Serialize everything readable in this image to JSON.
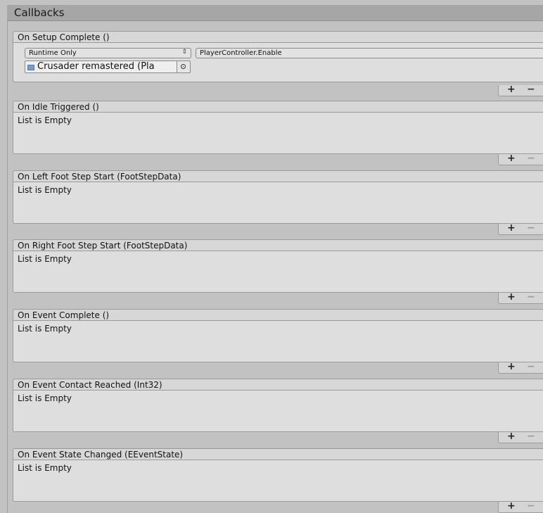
{
  "section_title": "Callbacks",
  "events": [
    {
      "title": "On Setup Complete ()",
      "listeners": [
        {
          "mode": "Runtime Only",
          "function": "PlayerController.Enable",
          "target": "Crusader remastered (Pla"
        }
      ]
    },
    {
      "title": "On Idle Triggered ()",
      "empty_text": "List is Empty"
    },
    {
      "title": "On Left Foot Step Start (FootStepData)",
      "empty_text": "List is Empty"
    },
    {
      "title": "On Right Foot Step Start (FootStepData)",
      "empty_text": "List is Empty"
    },
    {
      "title": "On Event Complete ()",
      "empty_text": "List is Empty"
    },
    {
      "title": "On Event Contact Reached (Int32)",
      "empty_text": "List is Empty"
    },
    {
      "title": "On Event State Changed (EEventState)",
      "empty_text": "List is Empty"
    }
  ],
  "controls": {
    "add": "+",
    "remove": "−",
    "dropdown_arrow": "⇕"
  },
  "icons": {
    "object_icon": "gameobject-icon",
    "picker_icon": "object-picker-icon"
  }
}
